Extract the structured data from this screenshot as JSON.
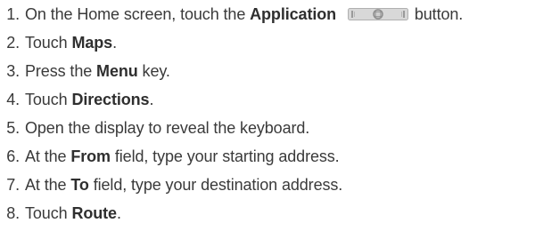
{
  "steps": [
    {
      "number": "1.",
      "before": "On the Home screen, touch the ",
      "bold": "Application",
      "after": "button.",
      "icon": "application-button-icon"
    },
    {
      "number": "2.",
      "before": "Touch ",
      "bold": "Maps",
      "after": "."
    },
    {
      "number": "3.",
      "before": "Press the ",
      "bold": "Menu",
      "after": " key."
    },
    {
      "number": "4.",
      "before": "Touch ",
      "bold": "Directions",
      "after": "."
    },
    {
      "number": "5.",
      "before": "Open the display to reveal the keyboard.",
      "bold": "",
      "after": ""
    },
    {
      "number": "6.",
      "before": "At the ",
      "bold": "From",
      "after": " field, type your starting address."
    },
    {
      "number": "7.",
      "before": "At the ",
      "bold": "To",
      "after": " field, type your destination address."
    },
    {
      "number": "8.",
      "before": "Touch ",
      "bold": "Route",
      "after": "."
    }
  ],
  "colors": {
    "text": "#3a3a3a",
    "bold_text": "#2f2f2f",
    "icon_fill": "#d4d4d4",
    "icon_stroke": "#8f8f8f"
  }
}
